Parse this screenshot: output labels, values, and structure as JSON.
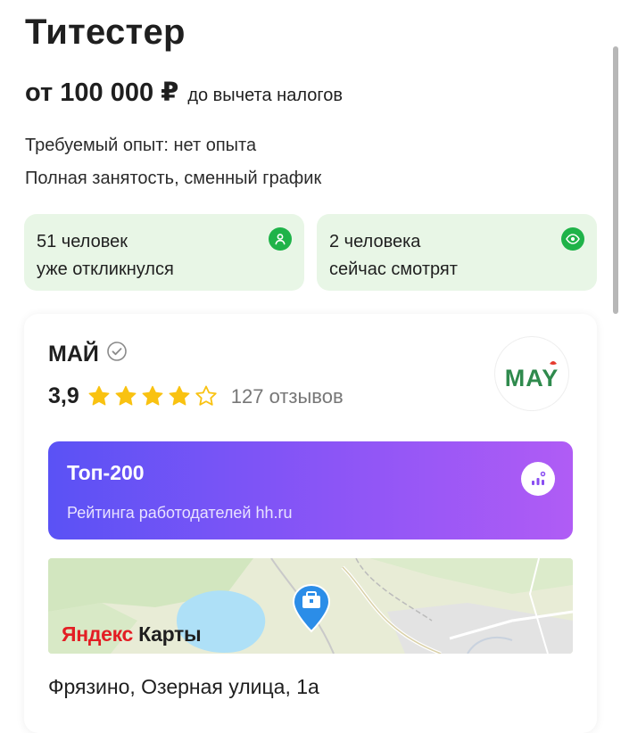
{
  "vacancy": {
    "title": "Титестер",
    "salary_amount": "от 100 000 ₽",
    "salary_note": "до вычета налогов",
    "experience": "Требуемый опыт: нет опыта",
    "schedule": "Полная занятость, сменный график"
  },
  "stats": [
    {
      "line1": "51 человек",
      "line2": "уже откликнулся",
      "icon": "person-icon"
    },
    {
      "line1": "2 человека",
      "line2": "сейчас смотрят",
      "icon": "eye-icon"
    }
  ],
  "employer": {
    "name": "МАЙ",
    "verified_icon": "verified-check-icon",
    "rating": "3,9",
    "rating_value": 3.9,
    "rating_max": 5,
    "reviews": "127 отзывов",
    "logo_text": "MAY"
  },
  "badge": {
    "title": "Топ-200",
    "subtitle": "Рейтинга работодателей hh.ru",
    "icon": "rating-chart-icon"
  },
  "map": {
    "brand_part1": "Яндекс",
    "brand_part2": " Карты",
    "pin_icon": "briefcase-pin-icon"
  },
  "address": "Фрязино, Озерная улица, 1а",
  "colors": {
    "stat_bg": "#e8f6e6",
    "stat_icon": "#1fb349",
    "star": "#f9c211",
    "banner_start": "#5a52f5",
    "banner_end": "#b05cf5",
    "map_pin": "#2b8de8"
  }
}
